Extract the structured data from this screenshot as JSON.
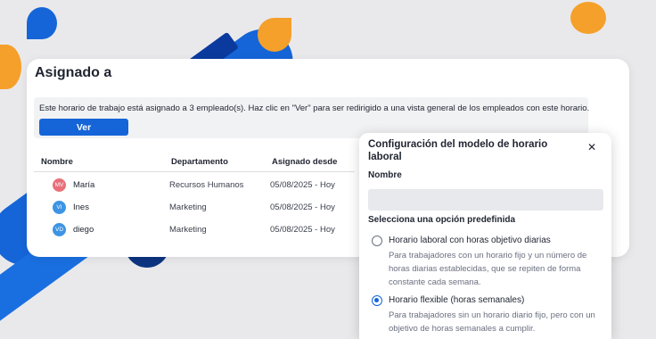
{
  "colors": {
    "accent": "#1565d8",
    "orange": "#f5a02a",
    "navy": "#0d3480",
    "background": "#e9e9ec"
  },
  "assigned": {
    "title": "Asignado a",
    "info_text": "Este horario de trabajo está asignado a 3 empleado(s). Haz clic en \"Ver\" para ser redirigido a una vista general de los empleados con este horario.",
    "view_button": "Ver",
    "columns": [
      "Nombre",
      "Departamento",
      "Asignado desde"
    ],
    "rows": [
      {
        "initials": "MV",
        "avatar_color": "#e8707a",
        "name": "María",
        "department": "Recursos Humanos",
        "since": "05/08/2025 - Hoy"
      },
      {
        "initials": "VI",
        "avatar_color": "#3d94e4",
        "name": "Ines",
        "department": "Marketing",
        "since": "05/08/2025 - Hoy"
      },
      {
        "initials": "VD",
        "avatar_color": "#3d94e4",
        "name": "diego",
        "department": "Marketing",
        "since": "05/08/2025 - Hoy"
      }
    ]
  },
  "config": {
    "title": "Configuración del modelo de horario laboral",
    "close_icon": "close-icon",
    "name_label": "Nombre",
    "name_value": "",
    "preset_label": "Selecciona una opción predefinida",
    "options": [
      {
        "title": "Horario laboral con horas objetivo diarias",
        "description": "Para trabajadores con un horario fijo y un número de horas diarias establecidas, que se repiten de forma constante cada semana.",
        "selected": false
      },
      {
        "title": "Horario flexible (horas semanales)",
        "description": "Para trabajadores sin un horario diario fijo, pero con un objetivo de horas semanales a cumplir.",
        "selected": true
      }
    ]
  }
}
